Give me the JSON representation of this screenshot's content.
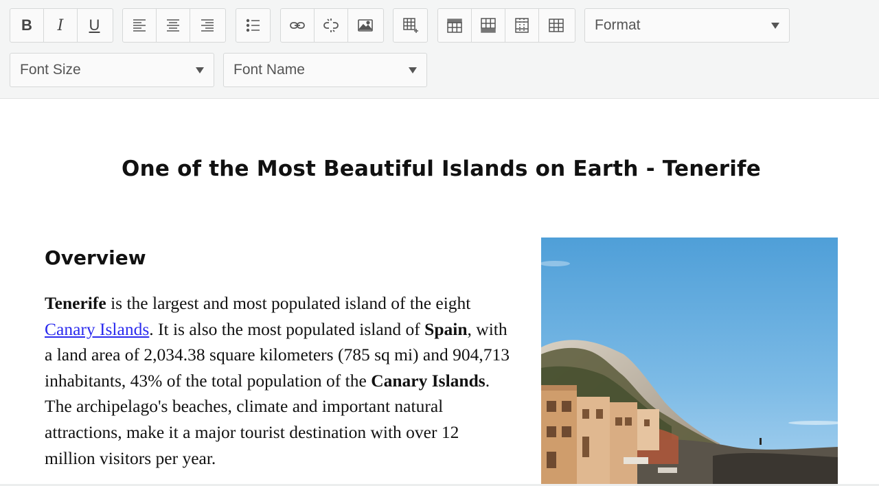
{
  "toolbar": {
    "bold_label": "B",
    "italic_label": "I",
    "underline_label": "U",
    "format": {
      "label": "Format"
    },
    "font_size": {
      "label": "Font Size"
    },
    "font_name": {
      "label": "Font Name"
    }
  },
  "document": {
    "title": "One of the Most Beautiful Islands on Earth - Tenerife",
    "section_heading": "Overview",
    "paragraph": {
      "t1": "Tenerife",
      "t2": " is the largest and most populated island of the eight ",
      "link": "Canary Islands",
      "t3": ". It is also the most populated island of ",
      "t4": "Spain",
      "t5": ", with a land area of 2,034.38 square kilometers (785 sq mi) and 904,713 inhabitants, 43% of the total population of the ",
      "t6": "Canary Islands",
      "t7": ". The archipelago's beaches, climate and important natural attractions, make it a major tourist destination with over 12 million visitors per year."
    }
  },
  "colors": {
    "toolbar_bg": "#f4f5f5",
    "link": "#2a2aee",
    "sky": "#5fa8dc"
  }
}
